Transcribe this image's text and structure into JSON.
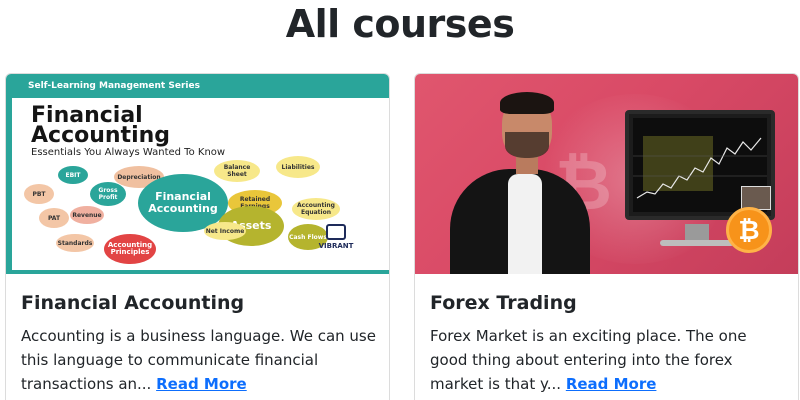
{
  "page": {
    "title": "All courses"
  },
  "courses": [
    {
      "title": "Financial Accounting",
      "description": "Accounting is a business language. We can use this language to communicate financial transactions an...",
      "read_more": "Read More",
      "thumbnail": {
        "series": "Self-Learning Management Series",
        "title_line1": "Financial",
        "title_line2": "Accounting",
        "subtitle": "Essentials You Always Wanted To Know",
        "center_bubble": "Financial Accounting",
        "assets_bubble": "Assets",
        "accounting_bubble": "Accounting Principles",
        "small_bubbles": [
          "EBIT",
          "Depreciation",
          "PBT",
          "PAT",
          "Revenue",
          "Gross Profit",
          "Standards",
          "Accounting Equation",
          "Net Income",
          "Cash Flows",
          "Balance Sheet",
          "Liabilities",
          "Retained Earnings"
        ],
        "publisher": "VIBRANT"
      }
    },
    {
      "title": "Forex Trading",
      "description": "Forex Market is an exciting place. The one good thing about entering into the forex market is that y...",
      "read_more": "Read More",
      "thumbnail": {
        "coin_symbol": "₿"
      }
    }
  ],
  "colors": {
    "link": "#0d6efd",
    "cover_teal": "#2aa59a",
    "forex_pink": "#d94a66",
    "bitcoin_orange": "#f7931a"
  }
}
